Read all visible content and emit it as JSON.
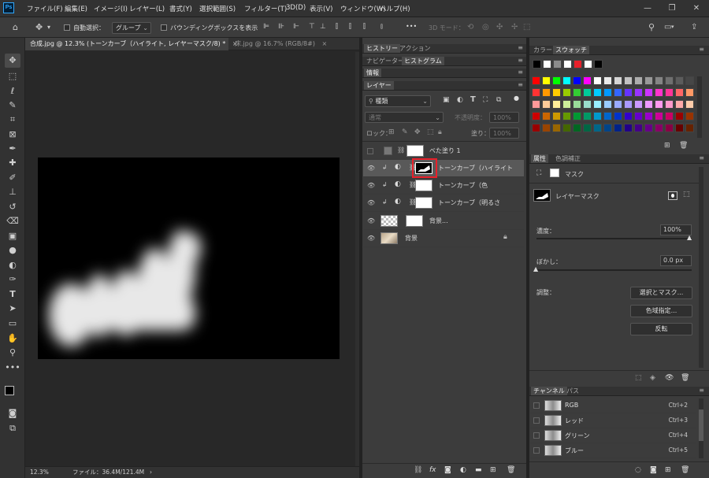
{
  "app": {
    "logo": "Ps"
  },
  "menu": [
    "ファイル(F)",
    "編集(E)",
    "イメージ(I)",
    "レイヤー(L)",
    "書式(Y)",
    "選択範囲(S)",
    "フィルター(T)",
    "3D(D)",
    "表示(V)",
    "ウィンドウ(W)",
    "ヘルプ(H)"
  ],
  "options": {
    "auto_select_label": "自動選択：",
    "group_value": "グループ",
    "bounding_box_label": "バウンディングボックスを表示",
    "more": "•••",
    "mode_3d": "3D モード："
  },
  "doc_tabs": [
    {
      "label": "合成.jpg @ 12.3% (トーンカーブ（ハイライト, レイヤーマスク/8) *",
      "close": "×"
    },
    {
      "label": "床.jpg @ 16.7% (RGB/8#)",
      "close": "×"
    }
  ],
  "status": {
    "zoom": "12.3%",
    "file": "ファイル：36.4M/121.4M",
    "arrow": "›"
  },
  "panel_tabs": {
    "history": "ヒストリー",
    "actions": "アクション",
    "navigator": "ナビゲーター",
    "histogram": "ヒストグラム",
    "info": "情報",
    "layers": "レイヤー",
    "color": "カラー",
    "swatches": "スウォッチ",
    "properties": "属性",
    "adjustments": "色調補正",
    "channels": "チャンネル",
    "paths": "パス"
  },
  "layers_panel": {
    "filter_value": "種類",
    "blend_mode": "通常",
    "opacity_label": "不透明度：",
    "opacity_value": "100%",
    "lock_label": "ロック：",
    "fill_label": "塗り：",
    "fill_value": "100%"
  },
  "layers": [
    {
      "name": "べた塗り 1",
      "visible": false,
      "kind": "fill"
    },
    {
      "name": "トーンカーブ（ハイライト",
      "visible": true,
      "kind": "curves",
      "selected": true
    },
    {
      "name": "トーンカーブ（色",
      "visible": true,
      "kind": "curves"
    },
    {
      "name": "トーンカーブ（明るさ",
      "visible": true,
      "kind": "curves"
    },
    {
      "name": "背景...",
      "visible": true,
      "kind": "image"
    },
    {
      "name": "背景",
      "visible": true,
      "kind": "background",
      "locked": true
    }
  ],
  "properties": {
    "mask_label": "マスク",
    "layer_mask_label": "レイヤーマスク",
    "density_label": "濃度：",
    "density_value": "100%",
    "feather_label": "ぼかし：",
    "feather_value": "0.0 px",
    "refine_label": "調整：",
    "select_mask_button": "選択とマスク...",
    "color_range_button": "色域指定...",
    "invert_button": "反転"
  },
  "channels": [
    {
      "name": "RGB",
      "shortcut": "Ctrl+2"
    },
    {
      "name": "レッド",
      "shortcut": "Ctrl+3"
    },
    {
      "name": "グリーン",
      "shortcut": "Ctrl+4"
    },
    {
      "name": "ブルー",
      "shortcut": "Ctrl+5"
    }
  ],
  "colors": {
    "highlight_box": "#e8202a",
    "selected_row": "#595959",
    "accent": "#31a8ff"
  }
}
